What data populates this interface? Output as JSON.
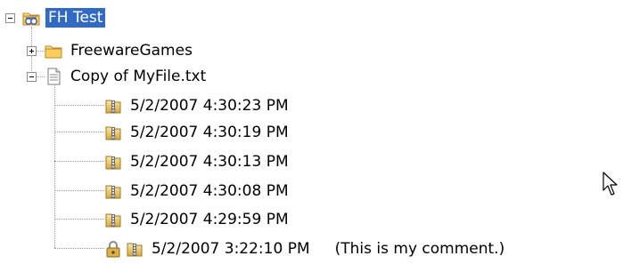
{
  "tree": {
    "root": {
      "label": "FH Test",
      "icon": "shared-folder-icon",
      "expanded": true,
      "selected": true
    },
    "children": [
      {
        "label": "FreewareGames",
        "icon": "folder-icon",
        "expanded": false
      },
      {
        "label": "Copy of MyFile.txt",
        "icon": "text-file-icon",
        "expanded": true
      },
      {
        "label": "5/2/2007 4:30:23 PM",
        "icon": "zip-archive-icon"
      },
      {
        "label": "5/2/2007 4:30:19 PM",
        "icon": "zip-archive-icon"
      },
      {
        "label": "5/2/2007 4:30:13 PM",
        "icon": "zip-archive-icon"
      },
      {
        "label": "5/2/2007 4:30:08 PM",
        "icon": "zip-archive-icon"
      },
      {
        "label": "5/2/2007 4:29:59 PM",
        "icon": "zip-archive-icon"
      },
      {
        "label": "5/2/2007 3:22:10 PM",
        "comment": "(This is my comment.)",
        "icon": "locked-zip-archive-icon"
      }
    ]
  },
  "colors": {
    "selection": "#316ac5",
    "selection_text": "#ffffff",
    "tree_lines": "#9a9a9a"
  },
  "cursor": {
    "icon": "arrow-cursor-icon"
  }
}
